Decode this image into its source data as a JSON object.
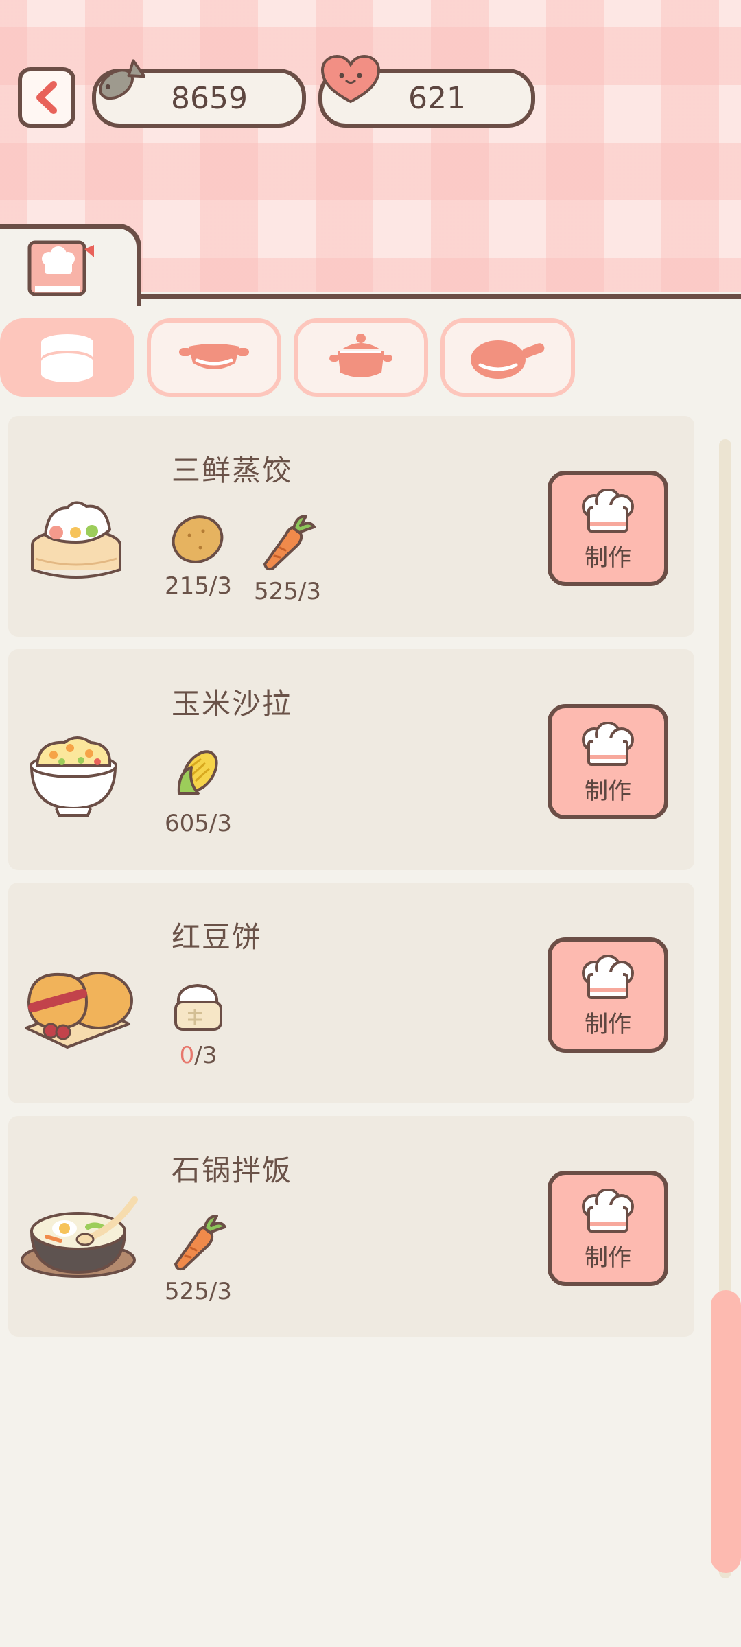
{
  "header": {
    "fish_count": "8659",
    "heart_count": "621"
  },
  "colors": {
    "accent": "#fdbab0",
    "outline": "#6b4e46",
    "card": "#efeae1",
    "zero_qty": "#e7776c"
  },
  "categories": [
    {
      "icon": "steamer-icon",
      "active": true
    },
    {
      "icon": "wok-icon",
      "active": false
    },
    {
      "icon": "pot-icon",
      "active": false
    },
    {
      "icon": "frying-pan-icon",
      "active": false
    }
  ],
  "recipes": [
    {
      "name": "三鲜蒸饺",
      "dish_icon": "steamed-dumplings-icon",
      "ingredients": [
        {
          "icon": "potato-icon",
          "have": "215",
          "need": "/3"
        },
        {
          "icon": "carrot-icon",
          "have": "525",
          "need": "/3"
        }
      ],
      "button": "制作"
    },
    {
      "name": "玉米沙拉",
      "dish_icon": "corn-salad-icon",
      "ingredients": [
        {
          "icon": "corn-icon",
          "have": "605",
          "need": "/3"
        }
      ],
      "button": "制作"
    },
    {
      "name": "红豆饼",
      "dish_icon": "red-bean-cake-icon",
      "ingredients": [
        {
          "icon": "flour-icon",
          "have": "0",
          "need": "/3"
        }
      ],
      "button": "制作"
    },
    {
      "name": "石锅拌饭",
      "dish_icon": "bibimbap-icon",
      "ingredients": [
        {
          "icon": "carrot-icon",
          "have": "525",
          "need": "/3"
        }
      ],
      "button": "制作"
    }
  ]
}
